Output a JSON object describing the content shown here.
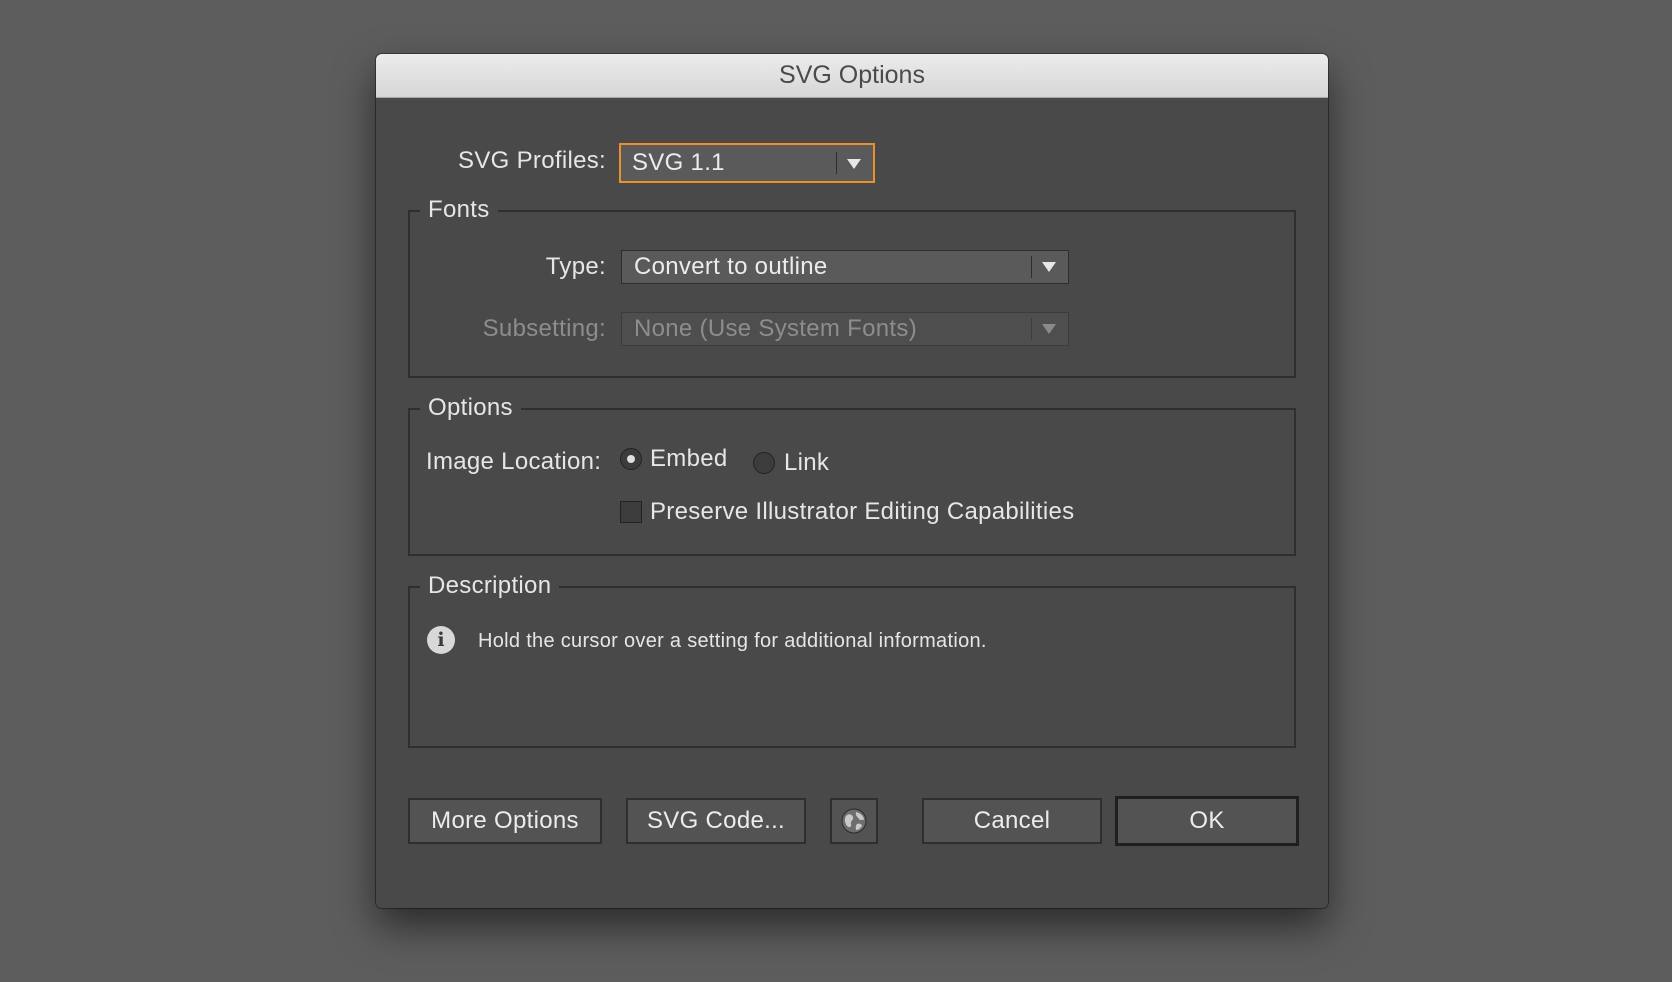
{
  "dialog": {
    "title": "SVG Options",
    "svg_profiles": {
      "label": "SVG Profiles:",
      "value": "SVG 1.1"
    },
    "fonts_group": {
      "legend": "Fonts",
      "type": {
        "label": "Type:",
        "value": "Convert to outline"
      },
      "subsetting": {
        "label": "Subsetting:",
        "value": "None (Use System Fonts)"
      }
    },
    "options_group": {
      "legend": "Options",
      "image_location": {
        "label": "Image Location:",
        "embed_label": "Embed",
        "link_label": "Link",
        "selected": "Embed"
      },
      "preserve_label": "Preserve Illustrator Editing Capabilities",
      "preserve_checked": false
    },
    "description_group": {
      "legend": "Description",
      "icon": "info-icon",
      "text": "Hold the cursor over a setting for additional information."
    },
    "buttons": {
      "more_options": "More Options",
      "svg_code": "SVG Code...",
      "web_icon": "globe-icon",
      "cancel": "Cancel",
      "ok": "OK"
    },
    "colors": {
      "focus_ring": "#e8922c",
      "dialog_bg": "#494949",
      "backdrop": "#5d5d5d"
    }
  }
}
